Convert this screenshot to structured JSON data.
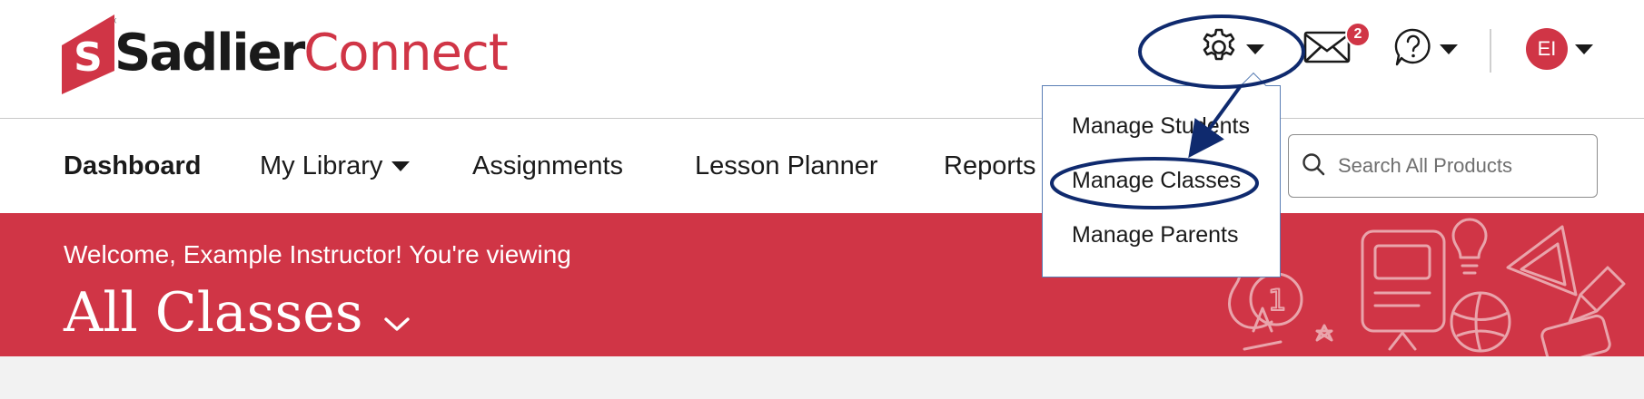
{
  "colors": {
    "brand_red": "#d03546",
    "annotation_blue": "#0f2a6e",
    "dropdown_border": "#5a7eb5"
  },
  "logo": {
    "part1": "Sadlier",
    "part2": "Connect",
    "mark_letter": "S",
    "registered": "®"
  },
  "header": {
    "settings_icon": "gear-icon",
    "messages_icon": "envelope-icon",
    "messages_badge": "2",
    "help_icon": "help-circle-icon",
    "avatar_initials": "EI"
  },
  "nav": {
    "items": [
      {
        "label": "Dashboard"
      },
      {
        "label": "My Library"
      },
      {
        "label": "Assignments"
      },
      {
        "label": "Lesson Planner"
      },
      {
        "label": "Reports"
      }
    ],
    "search_placeholder": "Search All Products"
  },
  "banner": {
    "welcome": "Welcome, Example Instructor! You're viewing",
    "class_title": "All Classes"
  },
  "settings_menu": {
    "items": [
      {
        "label": "Manage Students"
      },
      {
        "label": "Manage Classes"
      },
      {
        "label": "Manage Parents"
      }
    ]
  }
}
